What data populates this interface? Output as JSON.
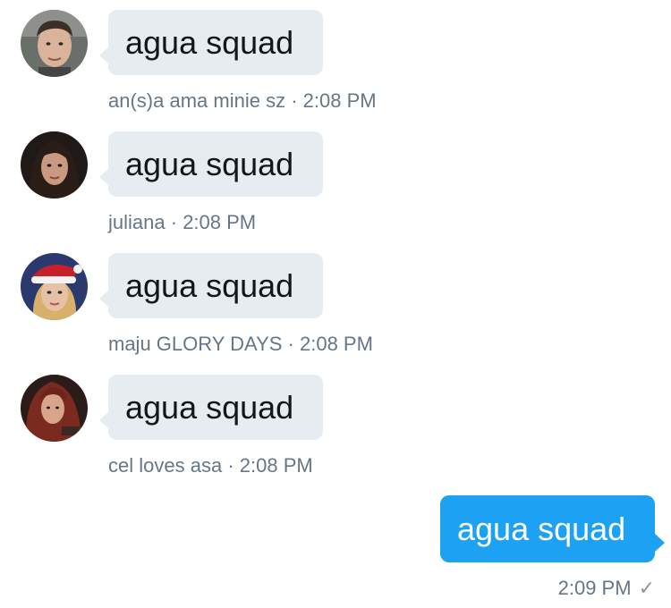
{
  "messages": [
    {
      "sender": "an(s)a ama minie sz",
      "text": "agua squad",
      "time": "2:08 PM",
      "avatar": "avatar-young-man"
    },
    {
      "sender": "juliana",
      "text": "agua squad",
      "time": "2:08 PM",
      "avatar": "avatar-dark-hair-woman"
    },
    {
      "sender": "maju GLORY DAYS",
      "text": "agua squad",
      "time": "2:08 PM",
      "avatar": "avatar-santa-hat-woman"
    },
    {
      "sender": "cel loves asa",
      "text": "agua squad",
      "time": "2:08 PM",
      "avatar": "avatar-red-hair-woman"
    }
  ],
  "sent": {
    "text": "agua squad",
    "time": "2:09 PM",
    "status_icon": "checkmark-icon"
  },
  "colors": {
    "received_bubble": "#e6ecf0",
    "sent_bubble": "#1da1f2",
    "meta_text": "#657786"
  }
}
